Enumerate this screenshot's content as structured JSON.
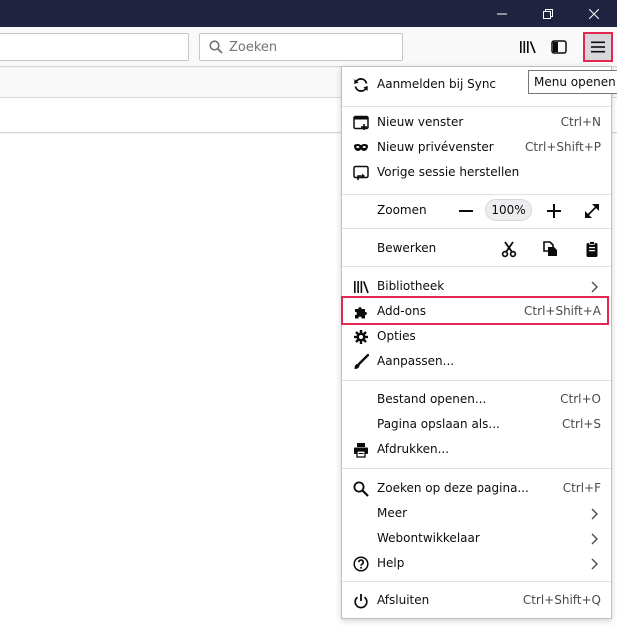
{
  "search": {
    "placeholder": "Zoeken"
  },
  "tooltip": {
    "text": "Menu openen"
  },
  "menu": {
    "sync": {
      "label": "Aanmelden bij Sync"
    },
    "new_window": {
      "label": "Nieuw venster",
      "shortcut": "Ctrl+N"
    },
    "private_window": {
      "label": "Nieuw privévenster",
      "shortcut": "Ctrl+Shift+P"
    },
    "restore_session": {
      "label": "Vorige sessie herstellen"
    },
    "zoom": {
      "label": "Zoomen",
      "value": "100%"
    },
    "edit": {
      "label": "Bewerken"
    },
    "library": {
      "label": "Bibliotheek"
    },
    "addons": {
      "label": "Add-ons",
      "shortcut": "Ctrl+Shift+A"
    },
    "options": {
      "label": "Opties"
    },
    "customize": {
      "label": "Aanpassen..."
    },
    "open_file": {
      "label": "Bestand openen...",
      "shortcut": "Ctrl+O"
    },
    "save_page": {
      "label": "Pagina opslaan als...",
      "shortcut": "Ctrl+S"
    },
    "print": {
      "label": "Afdrukken..."
    },
    "find": {
      "label": "Zoeken op deze pagina...",
      "shortcut": "Ctrl+F"
    },
    "more": {
      "label": "Meer"
    },
    "webdev": {
      "label": "Webontwikkelaar"
    },
    "help": {
      "label": "Help"
    },
    "quit": {
      "label": "Afsluiten",
      "shortcut": "Ctrl+Shift+Q"
    }
  },
  "colors": {
    "titlebar": "#202340",
    "highlight": "#e22850"
  }
}
